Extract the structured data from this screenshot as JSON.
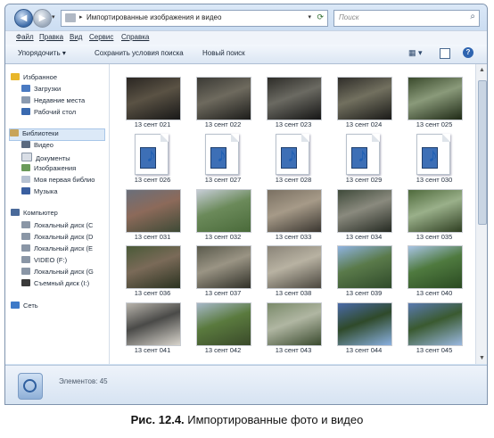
{
  "window": {
    "address_path": "Импортированные изображения и видео",
    "search_placeholder": "Поиск"
  },
  "menu": [
    "Файл",
    "Правка",
    "Вид",
    "Сервис",
    "Справка"
  ],
  "toolbar": {
    "organize": "Упорядочить ▾",
    "save_search": "Сохранить условия поиска",
    "new_search": "Новый поиск"
  },
  "nav": {
    "favorites": "Избранное",
    "downloads": "Загрузки",
    "recent": "Недавние места",
    "desktop": "Рабочий стол",
    "libraries": "Библиотеки",
    "video": "Видео",
    "documents": "Документы",
    "images": "Изображения",
    "my_library": "Моя первая библио",
    "music": "Музыка",
    "computer": "Компьютер",
    "disk_c": "Локальный диск (C",
    "disk_d": "Локальный диск (D",
    "disk_e": "Локальный диск (E",
    "video_f": "VIDEO (F:)",
    "disk_g": "Локальный диск (G",
    "removable": "Съемный диск (I:)",
    "network": "Сеть"
  },
  "items": [
    {
      "label": "13 сент 021",
      "kind": "photo",
      "colors": [
        "#2a2622",
        "#5a5244",
        "#181818"
      ]
    },
    {
      "label": "13 сент 022",
      "kind": "photo",
      "colors": [
        "#3b3a35",
        "#6e6a5e",
        "#1c1c1a"
      ]
    },
    {
      "label": "13 сент 023",
      "kind": "photo",
      "colors": [
        "#2d2c28",
        "#6b6a62",
        "#151515"
      ]
    },
    {
      "label": "13 сент 024",
      "kind": "photo",
      "colors": [
        "#2f2d29",
        "#72705f",
        "#1a1a18"
      ]
    },
    {
      "label": "13 сент 025",
      "kind": "photo",
      "colors": [
        "#3a4a2c",
        "#8a9a7a",
        "#1f2a16"
      ]
    },
    {
      "label": "13 сент 026",
      "kind": "video"
    },
    {
      "label": "13 сент 027",
      "kind": "video"
    },
    {
      "label": "13 сент 028",
      "kind": "video"
    },
    {
      "label": "13 сент 029",
      "kind": "video"
    },
    {
      "label": "13 сент 030",
      "kind": "video"
    },
    {
      "label": "13 сент 031",
      "kind": "photo",
      "colors": [
        "#6a6f7a",
        "#8c6a5a",
        "#3e4a36"
      ]
    },
    {
      "label": "13 сент 032",
      "kind": "photo",
      "colors": [
        "#c6cdd6",
        "#6b8a5a",
        "#4a6a3a"
      ]
    },
    {
      "label": "13 сент 033",
      "kind": "photo",
      "colors": [
        "#7a7062",
        "#a69a88",
        "#3a3630"
      ]
    },
    {
      "label": "13 сент 034",
      "kind": "photo",
      "colors": [
        "#3f4a3a",
        "#8a8a7e",
        "#252a22"
      ]
    },
    {
      "label": "13 сент 035",
      "kind": "photo",
      "colors": [
        "#4f6a3c",
        "#9ab08a",
        "#2f3f22"
      ]
    },
    {
      "label": "13 сент 036",
      "kind": "photo",
      "colors": [
        "#4a5a38",
        "#7a6a58",
        "#2a3220"
      ]
    },
    {
      "label": "13 сент 037",
      "kind": "photo",
      "colors": [
        "#5a5a4c",
        "#9a9484",
        "#303028"
      ]
    },
    {
      "label": "13 сент 038",
      "kind": "photo",
      "colors": [
        "#8a8478",
        "#b8b2a2",
        "#4a463e"
      ]
    },
    {
      "label": "13 сент 039",
      "kind": "photo",
      "colors": [
        "#8fb3e0",
        "#5a7a4a",
        "#2f4a2a"
      ]
    },
    {
      "label": "13 сент 040",
      "kind": "photo",
      "colors": [
        "#a8c4e4",
        "#4f7a3f",
        "#2a4a22"
      ]
    },
    {
      "label": "13 сент 041",
      "kind": "photo",
      "colors": [
        "#b8b4ac",
        "#4a4a48",
        "#d8d4cc"
      ]
    },
    {
      "label": "13 сент 042",
      "kind": "photo",
      "colors": [
        "#a6b8c8",
        "#5a7a3e",
        "#3a4a2a"
      ]
    },
    {
      "label": "13 сент 043",
      "kind": "photo",
      "colors": [
        "#7a8a6a",
        "#b0b6a2",
        "#3a4a2e"
      ]
    },
    {
      "label": "13 сент 044",
      "kind": "photo",
      "colors": [
        "#4a6aa8",
        "#2f4a2a",
        "#8ab0e0"
      ]
    },
    {
      "label": "13 сент 045",
      "kind": "photo",
      "colors": [
        "#5a7ab0",
        "#3a5a30",
        "#9ab8e0"
      ]
    }
  ],
  "status": {
    "count_label": "Элементов: 45"
  },
  "caption": {
    "bold": "Рис. 12.4.",
    "text": " Импортированные фото и видео"
  },
  "colors": {
    "accent": "#3e6ca8",
    "window_border": "#7f93ad"
  }
}
